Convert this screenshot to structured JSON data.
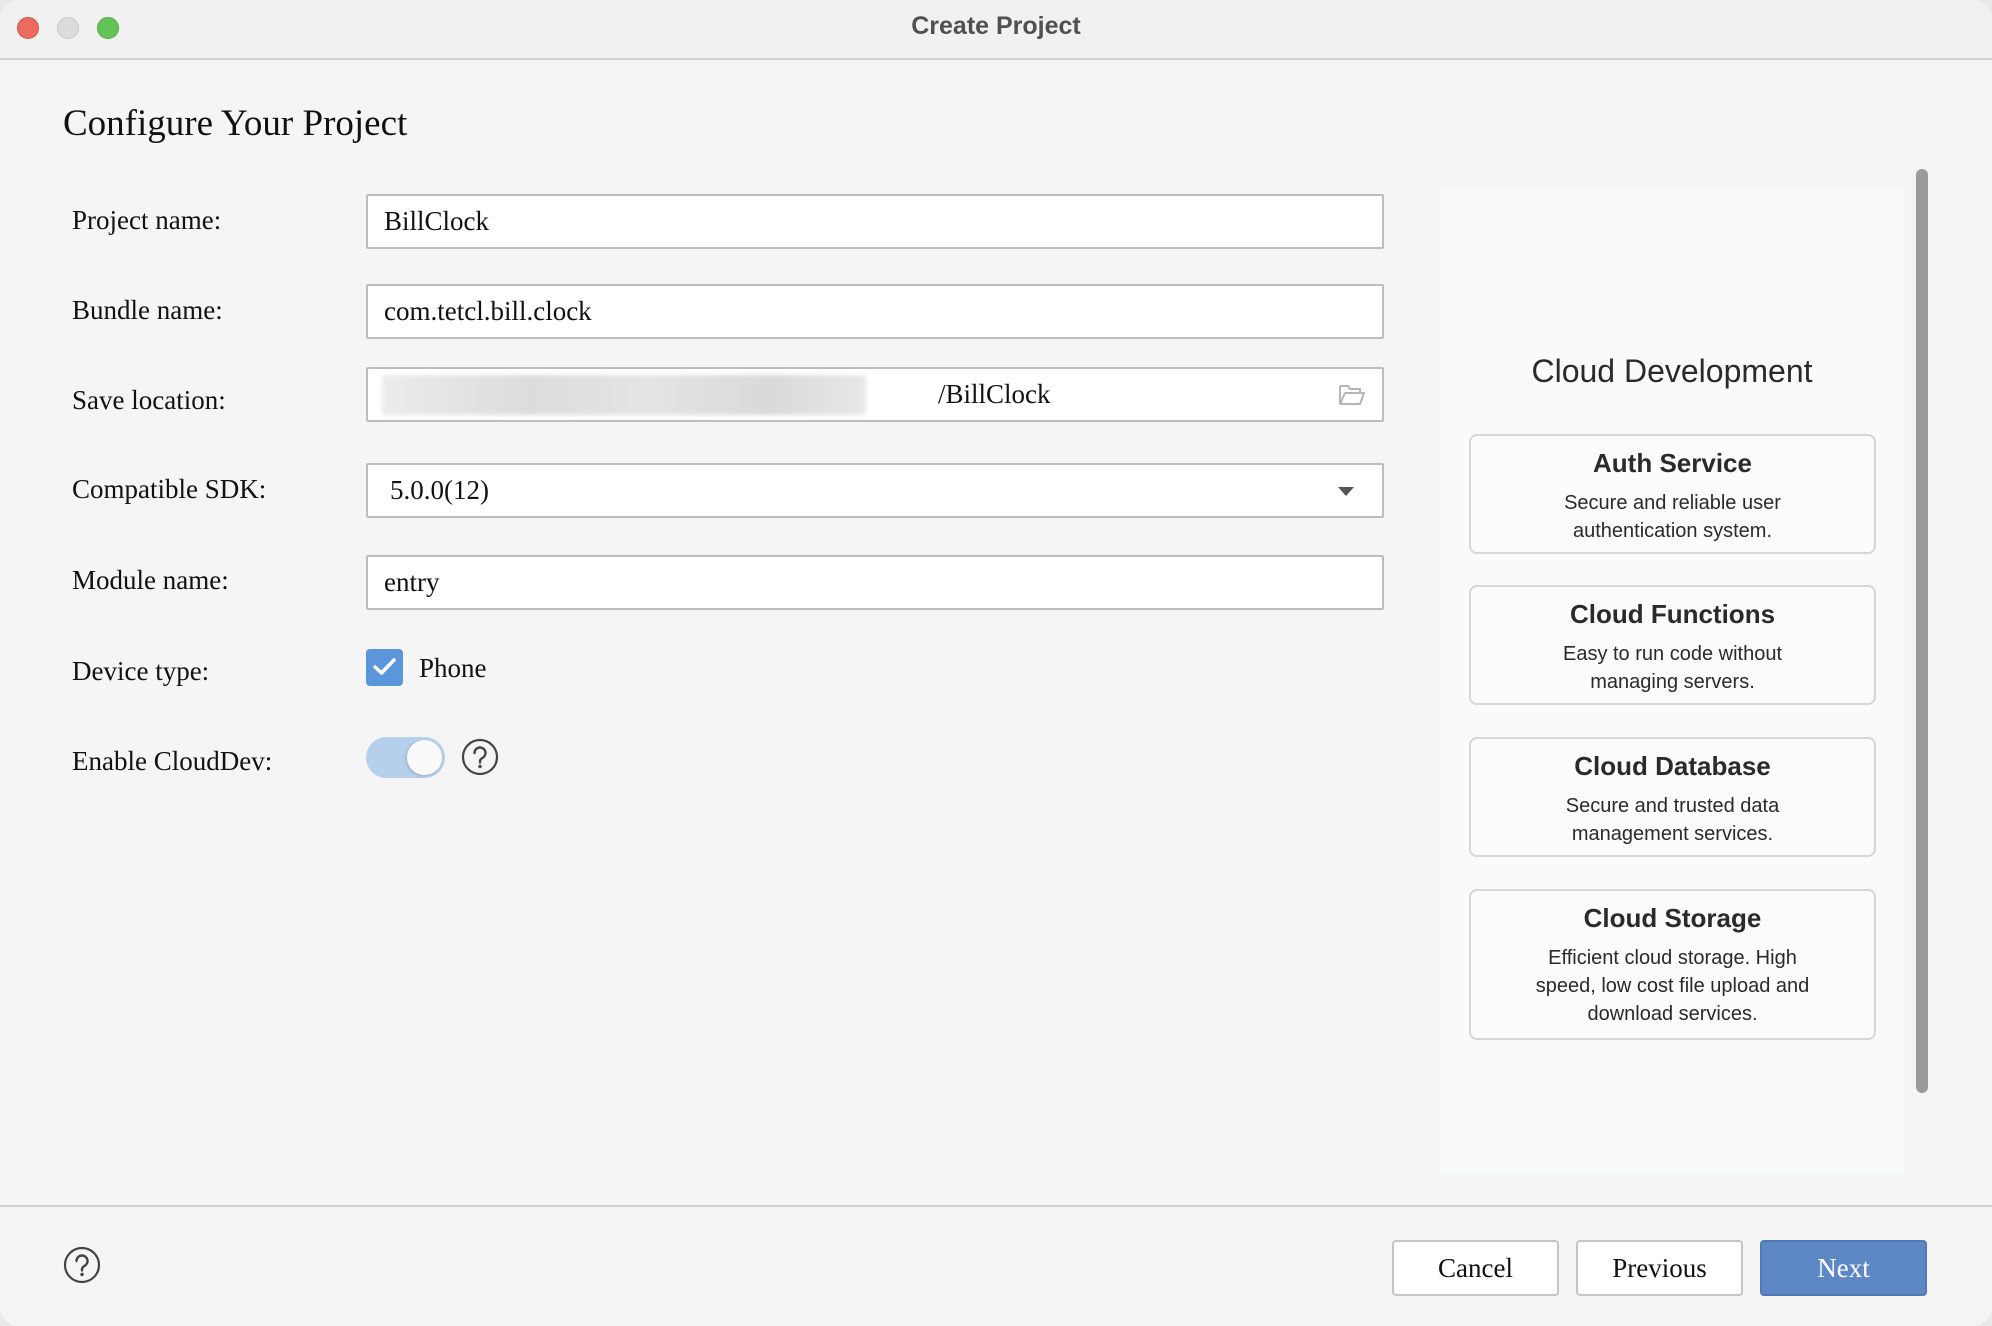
{
  "window": {
    "title": "Create Project",
    "controls": [
      "close",
      "minimize",
      "maximize"
    ]
  },
  "page": {
    "title": "Configure Your Project"
  },
  "form": {
    "project_name": {
      "label": "Project name:",
      "value": "BillClock"
    },
    "bundle_name": {
      "label": "Bundle name:",
      "value": "com.tetcl.bill.clock"
    },
    "save_location": {
      "label": "Save location:",
      "value_visible_suffix": "/BillClock",
      "prefix_redacted": true,
      "icon": "folder-open-icon"
    },
    "compatible_sdk": {
      "label": "Compatible SDK:",
      "selected": "5.0.0(12)",
      "icon": "dropdown-arrow-icon"
    },
    "module_name": {
      "label": "Module name:",
      "value": "entry"
    },
    "device_type": {
      "label": "Device type:",
      "options": [
        {
          "label": "Phone",
          "checked": true
        }
      ]
    },
    "enable_clouddev": {
      "label": "Enable CloudDev:",
      "enabled": true,
      "help_icon": "question-circle-icon"
    }
  },
  "cloud_panel": {
    "title": "Cloud Development",
    "cards": [
      {
        "title": "Auth Service",
        "description": "Secure and reliable user authentication system."
      },
      {
        "title": "Cloud Functions",
        "description": "Easy to run code without managing servers."
      },
      {
        "title": "Cloud Database",
        "description": "Secure and trusted data management services."
      },
      {
        "title": "Cloud Storage",
        "description": "Efficient cloud storage. High speed, low cost file upload and download services."
      }
    ]
  },
  "footer": {
    "help_icon": "question-circle-icon",
    "buttons": {
      "cancel": "Cancel",
      "previous": "Previous",
      "next": "Next"
    }
  },
  "colors": {
    "accent": "#5e87c5",
    "checkbox": "#5b95dc",
    "toggle_track": "#b6cfeb",
    "close": "#ec6b5f",
    "minimize": "#dcdcdc",
    "maximize": "#61c454"
  }
}
